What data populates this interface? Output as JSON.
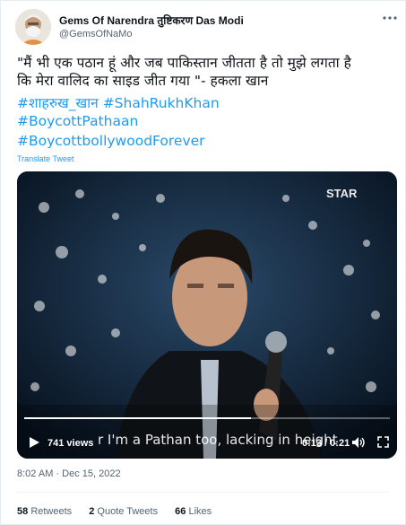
{
  "author": {
    "name": "Gems Of Narendra तुष्टिकरण Das Modi",
    "handle": "@GemsOfNaMo"
  },
  "tweet": {
    "text_lines": [
      "\"मैं भी एक पठान हूं और जब पाकिस्तान जीतता है तो मुझे लगता है",
      "कि मेरा वालिद का साइड जीत गया \"- हकला खान"
    ],
    "hashtags": [
      "#शाहरुख_खान #ShahRukhKhan",
      "#BoycottPathaan",
      "#BoycottbollywoodForever"
    ],
    "translate_label": "Translate Tweet"
  },
  "video": {
    "views": "741 views",
    "caption": "r I'm a Pathan too, lacking in height",
    "time": "0:13 / 0:21",
    "progress_fraction": 0.62,
    "channel_logo": "STAR"
  },
  "timestamp": "8:02 AM · Dec 15, 2022",
  "stats": [
    {
      "count": "58",
      "label": "Retweets"
    },
    {
      "count": "2",
      "label": "Quote Tweets"
    },
    {
      "count": "66",
      "label": "Likes"
    }
  ],
  "colors": {
    "link": "#1d9bf0",
    "text": "#0f1419",
    "secondary": "#536471"
  },
  "icons": [
    "more-icon",
    "play-icon",
    "volume-icon",
    "fullscreen-icon"
  ]
}
